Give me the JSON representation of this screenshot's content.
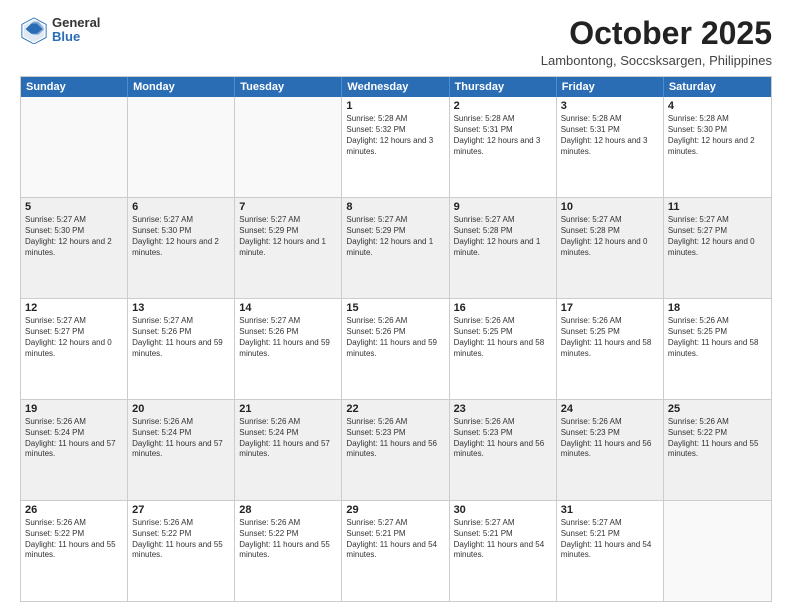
{
  "logo": {
    "general": "General",
    "blue": "Blue"
  },
  "title": "October 2025",
  "location": "Lambontong, Soccsksargen, Philippines",
  "days": [
    "Sunday",
    "Monday",
    "Tuesday",
    "Wednesday",
    "Thursday",
    "Friday",
    "Saturday"
  ],
  "rows": [
    [
      {
        "num": "",
        "sunrise": "",
        "sunset": "",
        "daylight": "",
        "empty": true
      },
      {
        "num": "",
        "sunrise": "",
        "sunset": "",
        "daylight": "",
        "empty": true
      },
      {
        "num": "",
        "sunrise": "",
        "sunset": "",
        "daylight": "",
        "empty": true
      },
      {
        "num": "1",
        "sunrise": "Sunrise: 5:28 AM",
        "sunset": "Sunset: 5:32 PM",
        "daylight": "Daylight: 12 hours and 3 minutes.",
        "empty": false
      },
      {
        "num": "2",
        "sunrise": "Sunrise: 5:28 AM",
        "sunset": "Sunset: 5:31 PM",
        "daylight": "Daylight: 12 hours and 3 minutes.",
        "empty": false
      },
      {
        "num": "3",
        "sunrise": "Sunrise: 5:28 AM",
        "sunset": "Sunset: 5:31 PM",
        "daylight": "Daylight: 12 hours and 3 minutes.",
        "empty": false
      },
      {
        "num": "4",
        "sunrise": "Sunrise: 5:28 AM",
        "sunset": "Sunset: 5:30 PM",
        "daylight": "Daylight: 12 hours and 2 minutes.",
        "empty": false
      }
    ],
    [
      {
        "num": "5",
        "sunrise": "Sunrise: 5:27 AM",
        "sunset": "Sunset: 5:30 PM",
        "daylight": "Daylight: 12 hours and 2 minutes.",
        "empty": false
      },
      {
        "num": "6",
        "sunrise": "Sunrise: 5:27 AM",
        "sunset": "Sunset: 5:30 PM",
        "daylight": "Daylight: 12 hours and 2 minutes.",
        "empty": false
      },
      {
        "num": "7",
        "sunrise": "Sunrise: 5:27 AM",
        "sunset": "Sunset: 5:29 PM",
        "daylight": "Daylight: 12 hours and 1 minute.",
        "empty": false
      },
      {
        "num": "8",
        "sunrise": "Sunrise: 5:27 AM",
        "sunset": "Sunset: 5:29 PM",
        "daylight": "Daylight: 12 hours and 1 minute.",
        "empty": false
      },
      {
        "num": "9",
        "sunrise": "Sunrise: 5:27 AM",
        "sunset": "Sunset: 5:28 PM",
        "daylight": "Daylight: 12 hours and 1 minute.",
        "empty": false
      },
      {
        "num": "10",
        "sunrise": "Sunrise: 5:27 AM",
        "sunset": "Sunset: 5:28 PM",
        "daylight": "Daylight: 12 hours and 0 minutes.",
        "empty": false
      },
      {
        "num": "11",
        "sunrise": "Sunrise: 5:27 AM",
        "sunset": "Sunset: 5:27 PM",
        "daylight": "Daylight: 12 hours and 0 minutes.",
        "empty": false
      }
    ],
    [
      {
        "num": "12",
        "sunrise": "Sunrise: 5:27 AM",
        "sunset": "Sunset: 5:27 PM",
        "daylight": "Daylight: 12 hours and 0 minutes.",
        "empty": false
      },
      {
        "num": "13",
        "sunrise": "Sunrise: 5:27 AM",
        "sunset": "Sunset: 5:26 PM",
        "daylight": "Daylight: 11 hours and 59 minutes.",
        "empty": false
      },
      {
        "num": "14",
        "sunrise": "Sunrise: 5:27 AM",
        "sunset": "Sunset: 5:26 PM",
        "daylight": "Daylight: 11 hours and 59 minutes.",
        "empty": false
      },
      {
        "num": "15",
        "sunrise": "Sunrise: 5:26 AM",
        "sunset": "Sunset: 5:26 PM",
        "daylight": "Daylight: 11 hours and 59 minutes.",
        "empty": false
      },
      {
        "num": "16",
        "sunrise": "Sunrise: 5:26 AM",
        "sunset": "Sunset: 5:25 PM",
        "daylight": "Daylight: 11 hours and 58 minutes.",
        "empty": false
      },
      {
        "num": "17",
        "sunrise": "Sunrise: 5:26 AM",
        "sunset": "Sunset: 5:25 PM",
        "daylight": "Daylight: 11 hours and 58 minutes.",
        "empty": false
      },
      {
        "num": "18",
        "sunrise": "Sunrise: 5:26 AM",
        "sunset": "Sunset: 5:25 PM",
        "daylight": "Daylight: 11 hours and 58 minutes.",
        "empty": false
      }
    ],
    [
      {
        "num": "19",
        "sunrise": "Sunrise: 5:26 AM",
        "sunset": "Sunset: 5:24 PM",
        "daylight": "Daylight: 11 hours and 57 minutes.",
        "empty": false
      },
      {
        "num": "20",
        "sunrise": "Sunrise: 5:26 AM",
        "sunset": "Sunset: 5:24 PM",
        "daylight": "Daylight: 11 hours and 57 minutes.",
        "empty": false
      },
      {
        "num": "21",
        "sunrise": "Sunrise: 5:26 AM",
        "sunset": "Sunset: 5:24 PM",
        "daylight": "Daylight: 11 hours and 57 minutes.",
        "empty": false
      },
      {
        "num": "22",
        "sunrise": "Sunrise: 5:26 AM",
        "sunset": "Sunset: 5:23 PM",
        "daylight": "Daylight: 11 hours and 56 minutes.",
        "empty": false
      },
      {
        "num": "23",
        "sunrise": "Sunrise: 5:26 AM",
        "sunset": "Sunset: 5:23 PM",
        "daylight": "Daylight: 11 hours and 56 minutes.",
        "empty": false
      },
      {
        "num": "24",
        "sunrise": "Sunrise: 5:26 AM",
        "sunset": "Sunset: 5:23 PM",
        "daylight": "Daylight: 11 hours and 56 minutes.",
        "empty": false
      },
      {
        "num": "25",
        "sunrise": "Sunrise: 5:26 AM",
        "sunset": "Sunset: 5:22 PM",
        "daylight": "Daylight: 11 hours and 55 minutes.",
        "empty": false
      }
    ],
    [
      {
        "num": "26",
        "sunrise": "Sunrise: 5:26 AM",
        "sunset": "Sunset: 5:22 PM",
        "daylight": "Daylight: 11 hours and 55 minutes.",
        "empty": false
      },
      {
        "num": "27",
        "sunrise": "Sunrise: 5:26 AM",
        "sunset": "Sunset: 5:22 PM",
        "daylight": "Daylight: 11 hours and 55 minutes.",
        "empty": false
      },
      {
        "num": "28",
        "sunrise": "Sunrise: 5:26 AM",
        "sunset": "Sunset: 5:22 PM",
        "daylight": "Daylight: 11 hours and 55 minutes.",
        "empty": false
      },
      {
        "num": "29",
        "sunrise": "Sunrise: 5:27 AM",
        "sunset": "Sunset: 5:21 PM",
        "daylight": "Daylight: 11 hours and 54 minutes.",
        "empty": false
      },
      {
        "num": "30",
        "sunrise": "Sunrise: 5:27 AM",
        "sunset": "Sunset: 5:21 PM",
        "daylight": "Daylight: 11 hours and 54 minutes.",
        "empty": false
      },
      {
        "num": "31",
        "sunrise": "Sunrise: 5:27 AM",
        "sunset": "Sunset: 5:21 PM",
        "daylight": "Daylight: 11 hours and 54 minutes.",
        "empty": false
      },
      {
        "num": "",
        "sunrise": "",
        "sunset": "",
        "daylight": "",
        "empty": true
      }
    ]
  ]
}
